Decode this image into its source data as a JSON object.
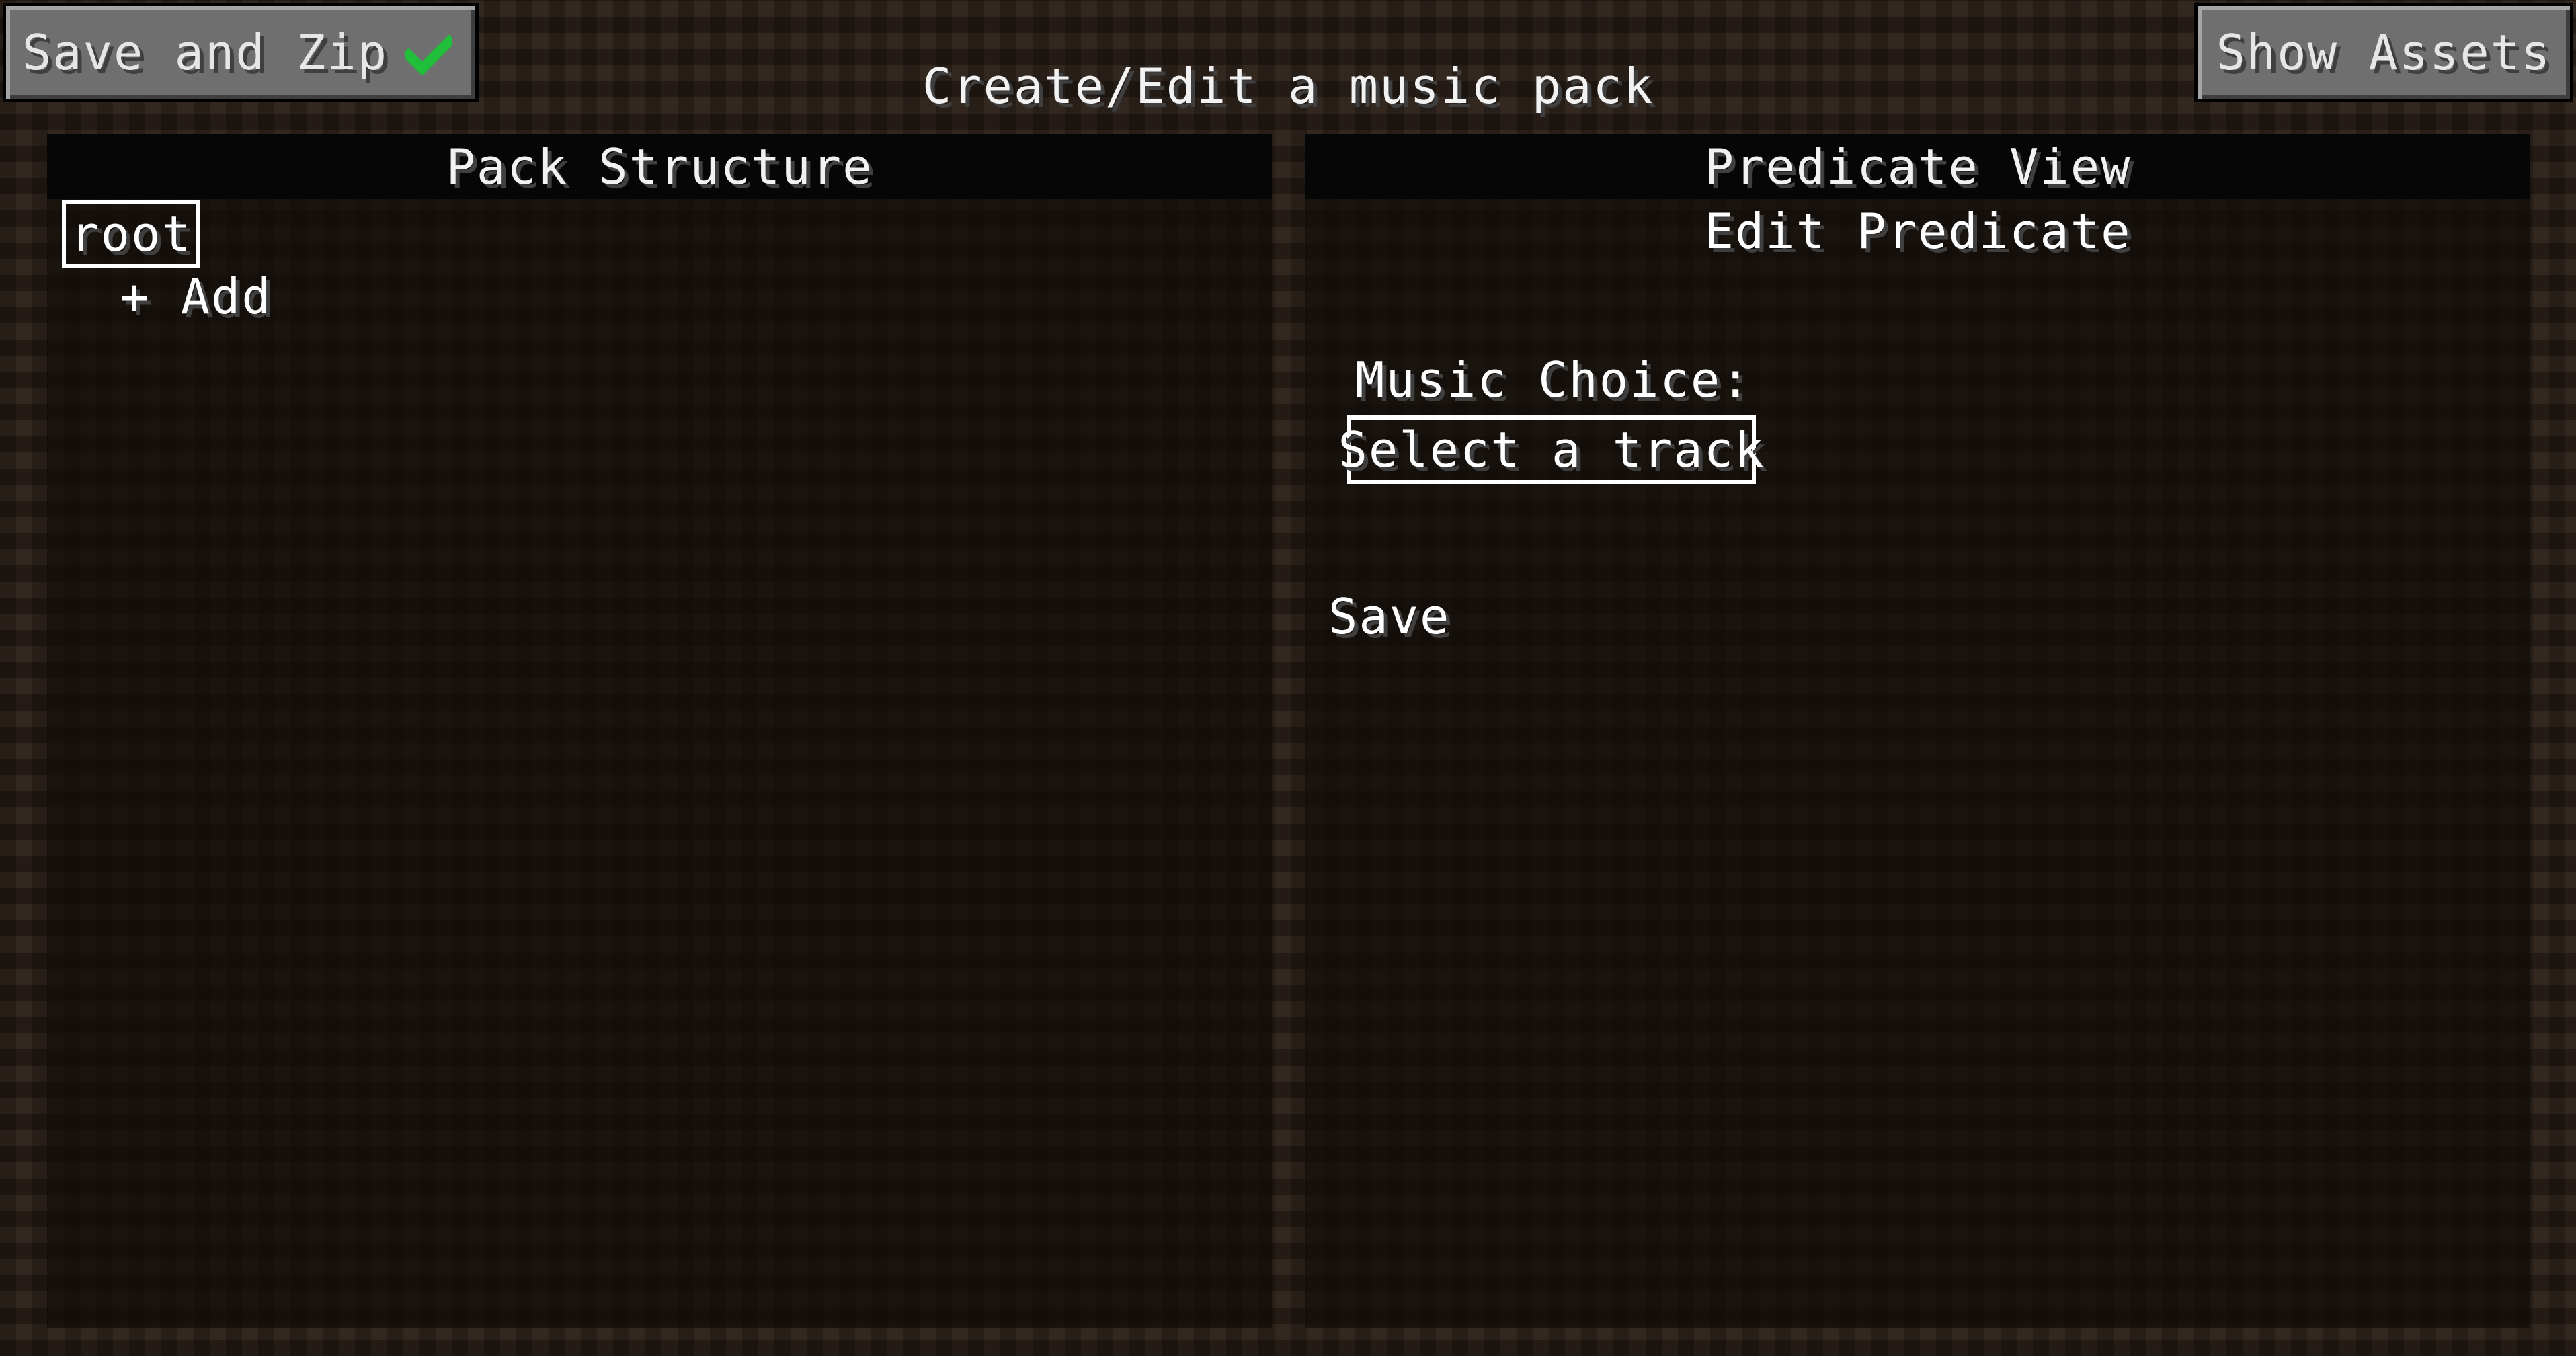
{
  "window": {
    "title": "Create/Edit a music pack"
  },
  "toolbar": {
    "save_zip_label": "Save and Zip",
    "save_zip_icon": "check-icon",
    "show_assets_label": "Show Assets"
  },
  "pack_structure": {
    "header": "Pack Structure",
    "root_label": "root",
    "add_label": "+ Add"
  },
  "predicate_view": {
    "header": "Predicate View",
    "subtitle": "Edit Predicate",
    "music_choice_label": "Music Choice:",
    "track_select_value": "Select a track",
    "save_label": "Save"
  },
  "colors": {
    "check": "#1fbf3a",
    "button_face": "#6f6f6f",
    "panel_header": "#070606"
  }
}
